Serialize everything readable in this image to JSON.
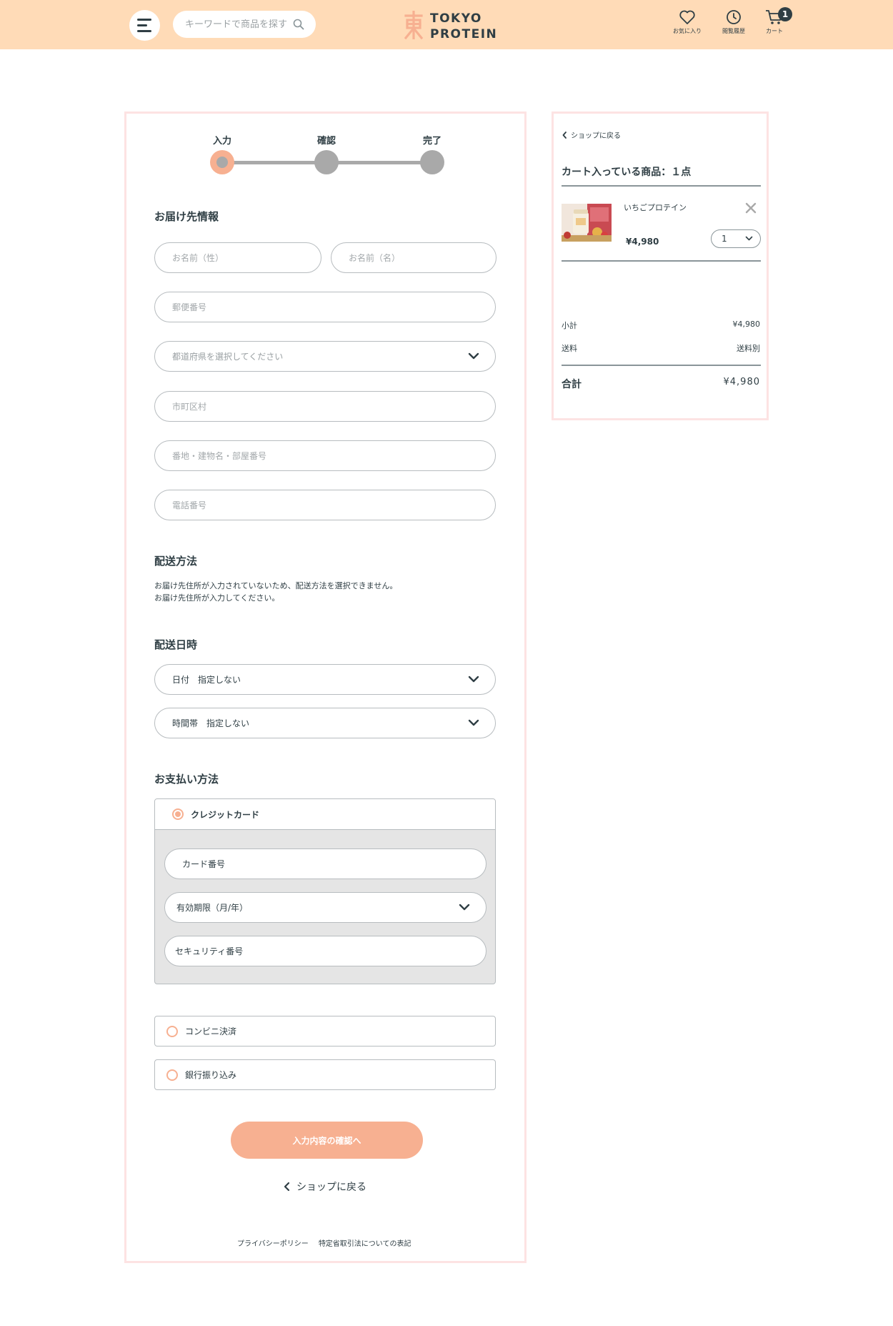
{
  "header": {
    "search_placeholder": "キーワードで商品を探す",
    "logo_line1": "TOKYO",
    "logo_line2": "PROTEIN",
    "favorites_label": "お気に入り",
    "history_label": "閲覧履歴",
    "cart_label": "カート",
    "cart_count": "1"
  },
  "steps": [
    "入力",
    "確認",
    "完了"
  ],
  "delivery": {
    "title": "お届け先情報",
    "last_name_placeholder": "お名前（性）",
    "first_name_placeholder": "お名前（名）",
    "postal_placeholder": "郵便番号",
    "prefecture_placeholder": "都道府県を選択してください",
    "city_placeholder": "市町区村",
    "address_placeholder": "番地・建物名・部屋番号",
    "phone_placeholder": "電話番号"
  },
  "shipping": {
    "title": "配送方法",
    "note_line1": "お届け先住所が入力されていないため、配送方法を選択できません。",
    "note_line2": "お届け先住所が入力してください。"
  },
  "schedule": {
    "title": "配送日時",
    "date_value": "日付　指定しない",
    "time_value": "時間帯　指定しない"
  },
  "payment": {
    "title": "お支払い方法",
    "credit_label": "クレジットカード",
    "card_number_placeholder": "カード番号",
    "expiry_value": "有効期限（月/年）",
    "security_placeholder": "セキュリティ番号",
    "convenience_label": "コンビニ決済",
    "bank_label": "銀行振り込み"
  },
  "actions": {
    "submit_label": "入力内容の確認へ",
    "back_label": "ショップに戻る"
  },
  "footer": {
    "privacy_label": "プライバシーポリシー",
    "law_label": "特定省取引法についての表記"
  },
  "cart": {
    "back_label": "ショップに戻る",
    "title": "カート入っている商品：１点",
    "item_name": "いちごプロテイン",
    "item_price": "¥4,980",
    "item_qty": "1",
    "subtotal_label": "小計",
    "subtotal_value": "¥4,980",
    "shipping_label": "送料",
    "shipping_value": "送料別",
    "total_label": "合計",
    "total_value": "¥4,980"
  },
  "colors": {
    "header_bg": "#ffdbb7",
    "accent": "#f7b091",
    "text": "#2f3e44",
    "panel_border": "#fde3e3"
  }
}
